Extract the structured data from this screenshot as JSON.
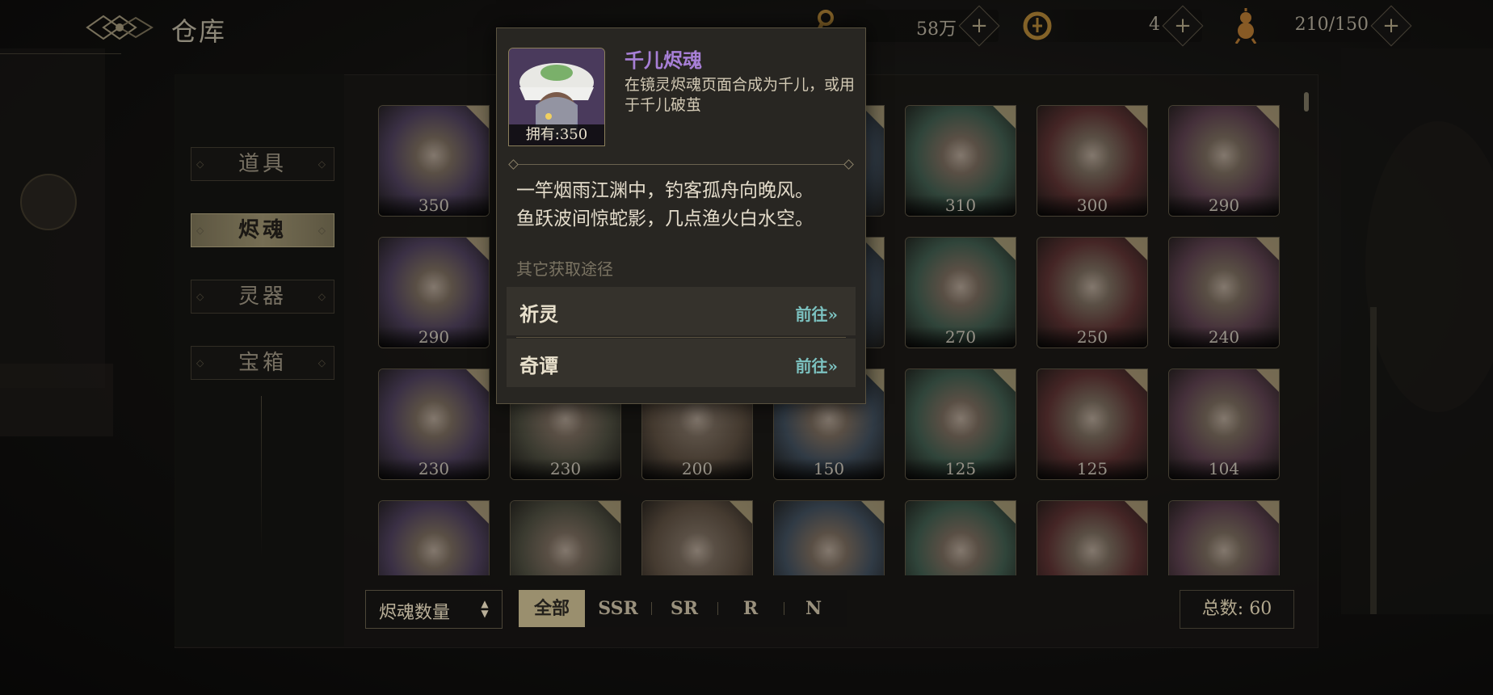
{
  "header": {
    "title": "仓库"
  },
  "resources": [
    {
      "icon": "key-icon",
      "value": "58万"
    },
    {
      "icon": "coin-icon",
      "value": "4"
    },
    {
      "icon": "stamina-gourd-icon",
      "value": "210/150"
    }
  ],
  "sidebar": {
    "items": [
      {
        "label": "道具",
        "active": false
      },
      {
        "label": "烬魂",
        "active": true
      },
      {
        "label": "灵器",
        "active": false
      },
      {
        "label": "宝箱",
        "active": false
      }
    ]
  },
  "grid": {
    "counts": [
      "350",
      "",
      "",
      "",
      "310",
      "300",
      "290",
      "290",
      "",
      "",
      "",
      "270",
      "250",
      "240",
      "230",
      "230",
      "200",
      "150",
      "125",
      "125",
      "104",
      "",
      "",
      "",
      "",
      "",
      "",
      ""
    ]
  },
  "bottom": {
    "sort_label": "烬魂数量",
    "filters": [
      "全部",
      "SSR",
      "SR",
      "R",
      "N"
    ],
    "active_filter": "全部",
    "total": "总数: 60"
  },
  "popup": {
    "name": "千儿烬魂",
    "owned": "拥有:350",
    "description": "在镜灵烬魂页面合成为千儿，或用于千儿破茧",
    "poem_line1": "一竿烟雨江渊中，钓客孤舟向晚风。",
    "poem_line2": "鱼跃波间惊蛇影，几点渔火白水空。",
    "other_sources_label": "其它获取途径",
    "routes": [
      {
        "name": "祈灵",
        "go": "前往»"
      },
      {
        "name": "奇谭",
        "go": "前往»"
      }
    ],
    "name_color": "#a77fd6",
    "go_color": "#7cc2c0"
  }
}
